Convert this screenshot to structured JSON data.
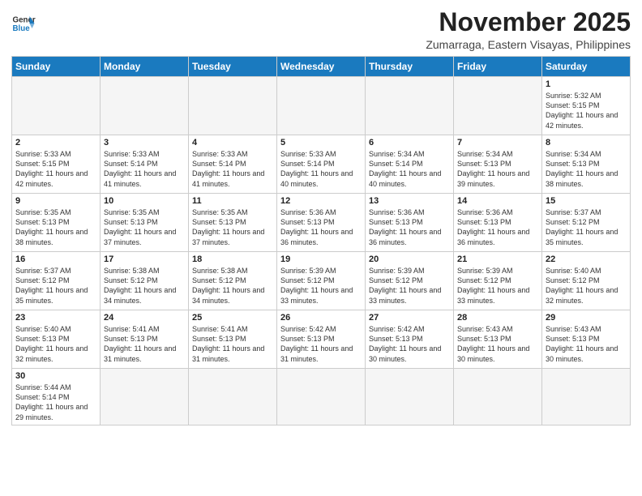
{
  "header": {
    "logo_general": "General",
    "logo_blue": "Blue",
    "month": "November 2025",
    "location": "Zumarraga, Eastern Visayas, Philippines"
  },
  "weekdays": [
    "Sunday",
    "Monday",
    "Tuesday",
    "Wednesday",
    "Thursday",
    "Friday",
    "Saturday"
  ],
  "weeks": [
    [
      {
        "day": "",
        "sunrise": "",
        "sunset": "",
        "daylight": ""
      },
      {
        "day": "",
        "sunrise": "",
        "sunset": "",
        "daylight": ""
      },
      {
        "day": "",
        "sunrise": "",
        "sunset": "",
        "daylight": ""
      },
      {
        "day": "",
        "sunrise": "",
        "sunset": "",
        "daylight": ""
      },
      {
        "day": "",
        "sunrise": "",
        "sunset": "",
        "daylight": ""
      },
      {
        "day": "",
        "sunrise": "",
        "sunset": "",
        "daylight": ""
      },
      {
        "day": "1",
        "sunrise": "Sunrise: 5:32 AM",
        "sunset": "Sunset: 5:15 PM",
        "daylight": "Daylight: 11 hours and 42 minutes."
      }
    ],
    [
      {
        "day": "2",
        "sunrise": "Sunrise: 5:33 AM",
        "sunset": "Sunset: 5:15 PM",
        "daylight": "Daylight: 11 hours and 42 minutes."
      },
      {
        "day": "3",
        "sunrise": "Sunrise: 5:33 AM",
        "sunset": "Sunset: 5:14 PM",
        "daylight": "Daylight: 11 hours and 41 minutes."
      },
      {
        "day": "4",
        "sunrise": "Sunrise: 5:33 AM",
        "sunset": "Sunset: 5:14 PM",
        "daylight": "Daylight: 11 hours and 41 minutes."
      },
      {
        "day": "5",
        "sunrise": "Sunrise: 5:33 AM",
        "sunset": "Sunset: 5:14 PM",
        "daylight": "Daylight: 11 hours and 40 minutes."
      },
      {
        "day": "6",
        "sunrise": "Sunrise: 5:34 AM",
        "sunset": "Sunset: 5:14 PM",
        "daylight": "Daylight: 11 hours and 40 minutes."
      },
      {
        "day": "7",
        "sunrise": "Sunrise: 5:34 AM",
        "sunset": "Sunset: 5:13 PM",
        "daylight": "Daylight: 11 hours and 39 minutes."
      },
      {
        "day": "8",
        "sunrise": "Sunrise: 5:34 AM",
        "sunset": "Sunset: 5:13 PM",
        "daylight": "Daylight: 11 hours and 38 minutes."
      }
    ],
    [
      {
        "day": "9",
        "sunrise": "Sunrise: 5:35 AM",
        "sunset": "Sunset: 5:13 PM",
        "daylight": "Daylight: 11 hours and 38 minutes."
      },
      {
        "day": "10",
        "sunrise": "Sunrise: 5:35 AM",
        "sunset": "Sunset: 5:13 PM",
        "daylight": "Daylight: 11 hours and 37 minutes."
      },
      {
        "day": "11",
        "sunrise": "Sunrise: 5:35 AM",
        "sunset": "Sunset: 5:13 PM",
        "daylight": "Daylight: 11 hours and 37 minutes."
      },
      {
        "day": "12",
        "sunrise": "Sunrise: 5:36 AM",
        "sunset": "Sunset: 5:13 PM",
        "daylight": "Daylight: 11 hours and 36 minutes."
      },
      {
        "day": "13",
        "sunrise": "Sunrise: 5:36 AM",
        "sunset": "Sunset: 5:13 PM",
        "daylight": "Daylight: 11 hours and 36 minutes."
      },
      {
        "day": "14",
        "sunrise": "Sunrise: 5:36 AM",
        "sunset": "Sunset: 5:13 PM",
        "daylight": "Daylight: 11 hours and 36 minutes."
      },
      {
        "day": "15",
        "sunrise": "Sunrise: 5:37 AM",
        "sunset": "Sunset: 5:12 PM",
        "daylight": "Daylight: 11 hours and 35 minutes."
      }
    ],
    [
      {
        "day": "16",
        "sunrise": "Sunrise: 5:37 AM",
        "sunset": "Sunset: 5:12 PM",
        "daylight": "Daylight: 11 hours and 35 minutes."
      },
      {
        "day": "17",
        "sunrise": "Sunrise: 5:38 AM",
        "sunset": "Sunset: 5:12 PM",
        "daylight": "Daylight: 11 hours and 34 minutes."
      },
      {
        "day": "18",
        "sunrise": "Sunrise: 5:38 AM",
        "sunset": "Sunset: 5:12 PM",
        "daylight": "Daylight: 11 hours and 34 minutes."
      },
      {
        "day": "19",
        "sunrise": "Sunrise: 5:39 AM",
        "sunset": "Sunset: 5:12 PM",
        "daylight": "Daylight: 11 hours and 33 minutes."
      },
      {
        "day": "20",
        "sunrise": "Sunrise: 5:39 AM",
        "sunset": "Sunset: 5:12 PM",
        "daylight": "Daylight: 11 hours and 33 minutes."
      },
      {
        "day": "21",
        "sunrise": "Sunrise: 5:39 AM",
        "sunset": "Sunset: 5:12 PM",
        "daylight": "Daylight: 11 hours and 33 minutes."
      },
      {
        "day": "22",
        "sunrise": "Sunrise: 5:40 AM",
        "sunset": "Sunset: 5:12 PM",
        "daylight": "Daylight: 11 hours and 32 minutes."
      }
    ],
    [
      {
        "day": "23",
        "sunrise": "Sunrise: 5:40 AM",
        "sunset": "Sunset: 5:13 PM",
        "daylight": "Daylight: 11 hours and 32 minutes."
      },
      {
        "day": "24",
        "sunrise": "Sunrise: 5:41 AM",
        "sunset": "Sunset: 5:13 PM",
        "daylight": "Daylight: 11 hours and 31 minutes."
      },
      {
        "day": "25",
        "sunrise": "Sunrise: 5:41 AM",
        "sunset": "Sunset: 5:13 PM",
        "daylight": "Daylight: 11 hours and 31 minutes."
      },
      {
        "day": "26",
        "sunrise": "Sunrise: 5:42 AM",
        "sunset": "Sunset: 5:13 PM",
        "daylight": "Daylight: 11 hours and 31 minutes."
      },
      {
        "day": "27",
        "sunrise": "Sunrise: 5:42 AM",
        "sunset": "Sunset: 5:13 PM",
        "daylight": "Daylight: 11 hours and 30 minutes."
      },
      {
        "day": "28",
        "sunrise": "Sunrise: 5:43 AM",
        "sunset": "Sunset: 5:13 PM",
        "daylight": "Daylight: 11 hours and 30 minutes."
      },
      {
        "day": "29",
        "sunrise": "Sunrise: 5:43 AM",
        "sunset": "Sunset: 5:13 PM",
        "daylight": "Daylight: 11 hours and 30 minutes."
      }
    ],
    [
      {
        "day": "30",
        "sunrise": "Sunrise: 5:44 AM",
        "sunset": "Sunset: 5:14 PM",
        "daylight": "Daylight: 11 hours and 29 minutes."
      },
      {
        "day": "",
        "sunrise": "",
        "sunset": "",
        "daylight": ""
      },
      {
        "day": "",
        "sunrise": "",
        "sunset": "",
        "daylight": ""
      },
      {
        "day": "",
        "sunrise": "",
        "sunset": "",
        "daylight": ""
      },
      {
        "day": "",
        "sunrise": "",
        "sunset": "",
        "daylight": ""
      },
      {
        "day": "",
        "sunrise": "",
        "sunset": "",
        "daylight": ""
      },
      {
        "day": "",
        "sunrise": "",
        "sunset": "",
        "daylight": ""
      }
    ]
  ]
}
